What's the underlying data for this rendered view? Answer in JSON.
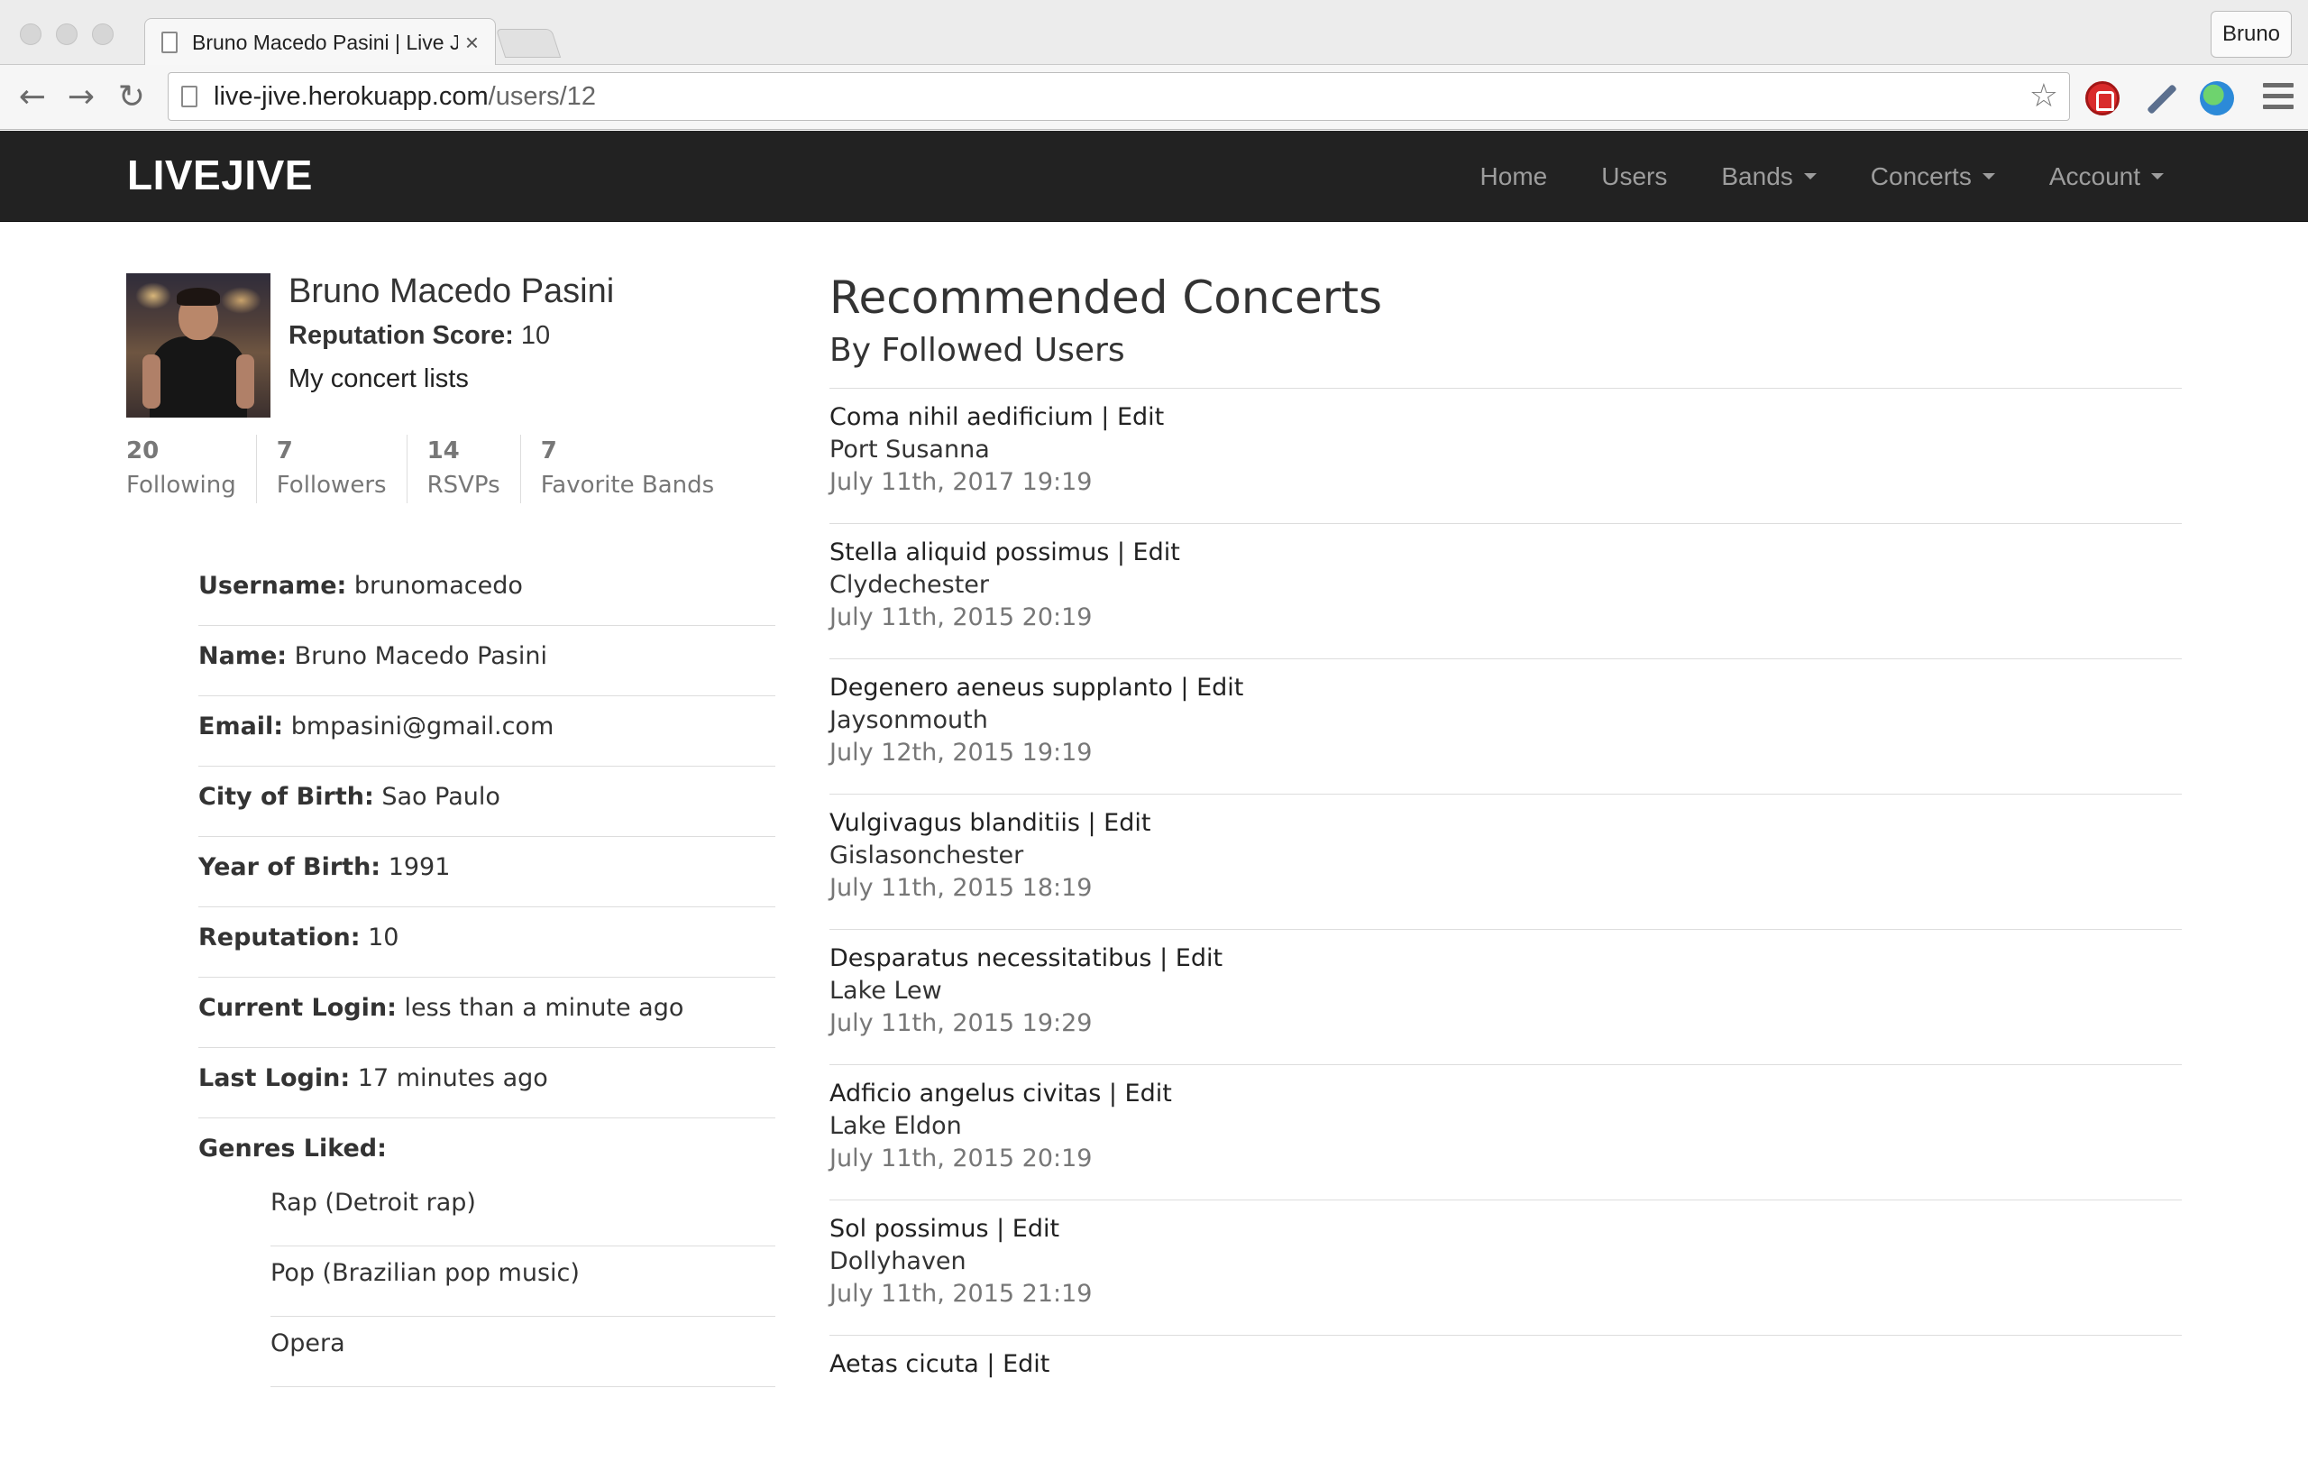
{
  "browser": {
    "tab_title": "Bruno Macedo Pasini | Live Jive",
    "tab_close": "×",
    "profile_label": "Bruno",
    "url_host": "live-jive.herokuapp.com",
    "url_path": "/users/12"
  },
  "nav": {
    "brand": "LIVEJIVE",
    "links": [
      "Home",
      "Users",
      "Bands",
      "Concerts",
      "Account"
    ]
  },
  "profile": {
    "name": "Bruno Macedo Pasini",
    "reputation_label": "Reputation Score:",
    "reputation_value": "10",
    "concert_lists_link": "My concert lists",
    "stats": [
      {
        "num": "20",
        "label": "Following"
      },
      {
        "num": "7",
        "label": "Followers"
      },
      {
        "num": "14",
        "label": "RSVPs"
      },
      {
        "num": "7",
        "label": "Favorite Bands"
      }
    ],
    "details": [
      {
        "label": "Username:",
        "value": "brunomacedo"
      },
      {
        "label": "Name:",
        "value": "Bruno Macedo Pasini"
      },
      {
        "label": "Email:",
        "value": "bmpasini@gmail.com"
      },
      {
        "label": "City of Birth:",
        "value": "Sao Paulo"
      },
      {
        "label": "Year of Birth:",
        "value": "1991"
      },
      {
        "label": "Reputation:",
        "value": "10"
      },
      {
        "label": "Current Login:",
        "value": "less than a minute ago"
      },
      {
        "label": "Last Login:",
        "value": "17 minutes ago"
      }
    ],
    "genres_label": "Genres Liked:",
    "genres": [
      "Rap (Detroit rap)",
      "Pop (Brazilian pop music)",
      "Opera"
    ]
  },
  "recommended": {
    "title": "Recommended Concerts",
    "subtitle": "By Followed Users",
    "concerts": [
      {
        "title": "Coma nihil aedificium | Edit",
        "city": "Port Susanna",
        "date": "July 11th, 2017 19:19"
      },
      {
        "title": "Stella aliquid possimus | Edit",
        "city": "Clydechester",
        "date": "July 11th, 2015 20:19"
      },
      {
        "title": "Degenero aeneus supplanto | Edit",
        "city": "Jaysonmouth",
        "date": "July 12th, 2015 19:19"
      },
      {
        "title": "Vulgivagus blanditiis | Edit",
        "city": "Gislasonchester",
        "date": "July 11th, 2015 18:19"
      },
      {
        "title": "Desparatus necessitatibus | Edit",
        "city": "Lake Lew",
        "date": "July 11th, 2015 19:29"
      },
      {
        "title": "Adficio angelus civitas | Edit",
        "city": "Lake Eldon",
        "date": "July 11th, 2015 20:19"
      },
      {
        "title": "Sol possimus | Edit",
        "city": "Dollyhaven",
        "date": "July 11th, 2015 21:19"
      },
      {
        "title": "Aetas cicuta | Edit",
        "city": "",
        "date": ""
      }
    ]
  }
}
